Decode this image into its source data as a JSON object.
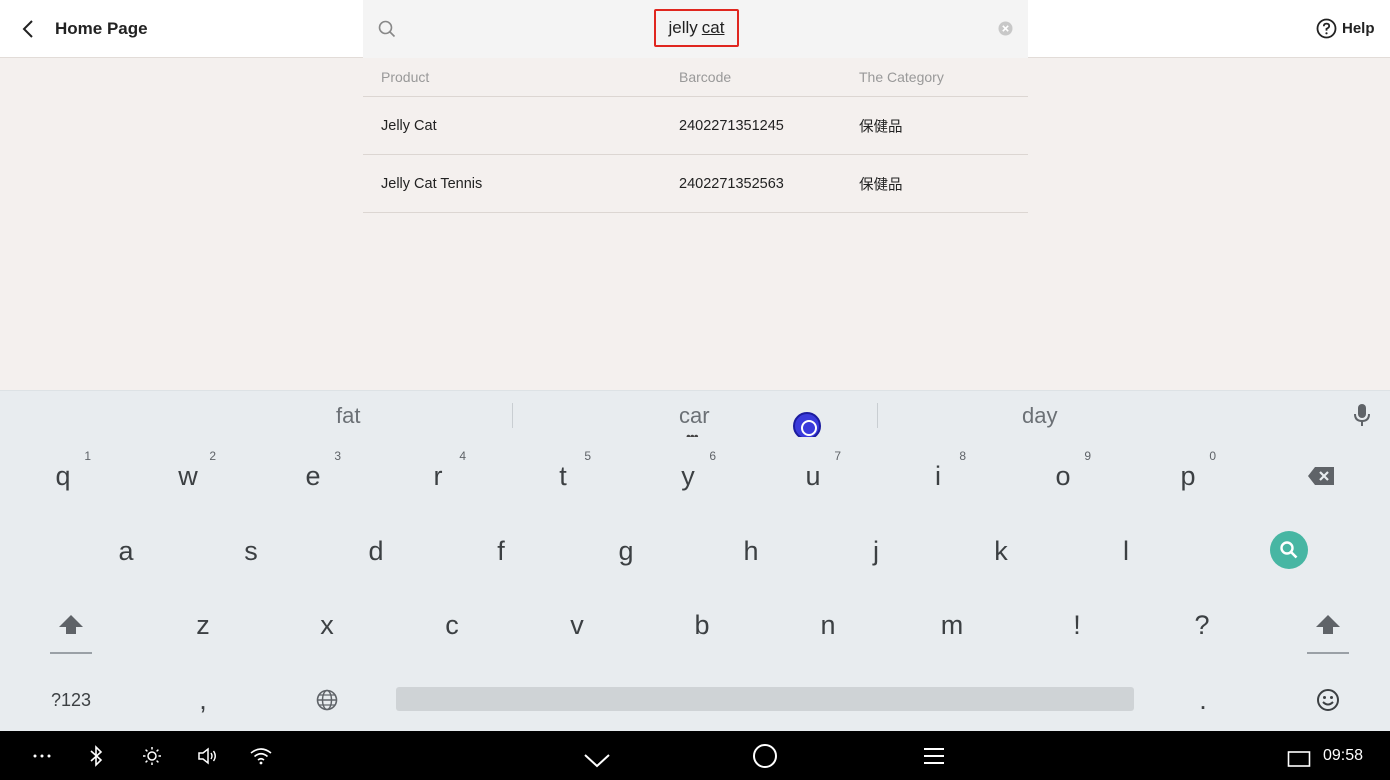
{
  "header": {
    "title": "Home Page",
    "search_value_part1": "jelly",
    "search_value_part2": "cat",
    "help_label": "Help"
  },
  "table": {
    "headers": [
      "Product",
      "Barcode",
      "The Category"
    ],
    "rows": [
      {
        "product": "Jelly Cat",
        "barcode": "2402271351245",
        "category": "保健品"
      },
      {
        "product": "Jelly Cat Tennis",
        "barcode": "2402271352563",
        "category": "保健品"
      }
    ]
  },
  "keyboard": {
    "suggestions": [
      "fat",
      "car",
      "day"
    ],
    "row1": [
      {
        "key": "q",
        "hint": "1"
      },
      {
        "key": "w",
        "hint": "2"
      },
      {
        "key": "e",
        "hint": "3"
      },
      {
        "key": "r",
        "hint": "4"
      },
      {
        "key": "t",
        "hint": "5"
      },
      {
        "key": "y",
        "hint": "6"
      },
      {
        "key": "u",
        "hint": "7"
      },
      {
        "key": "i",
        "hint": "8"
      },
      {
        "key": "o",
        "hint": "9"
      },
      {
        "key": "p",
        "hint": "0"
      }
    ],
    "row2": [
      "a",
      "s",
      "d",
      "f",
      "g",
      "h",
      "j",
      "k",
      "l"
    ],
    "row3": [
      "z",
      "x",
      "c",
      "v",
      "b",
      "n",
      "m",
      "!",
      "?"
    ],
    "symbols_label": "?123",
    "comma": ",",
    "period": ".",
    "search_key_color": "#47b6a3"
  },
  "statusbar": {
    "time": "09:58"
  },
  "colors": {
    "highlight_border": "#e0261f",
    "touch_indicator": "#3a3adb"
  }
}
